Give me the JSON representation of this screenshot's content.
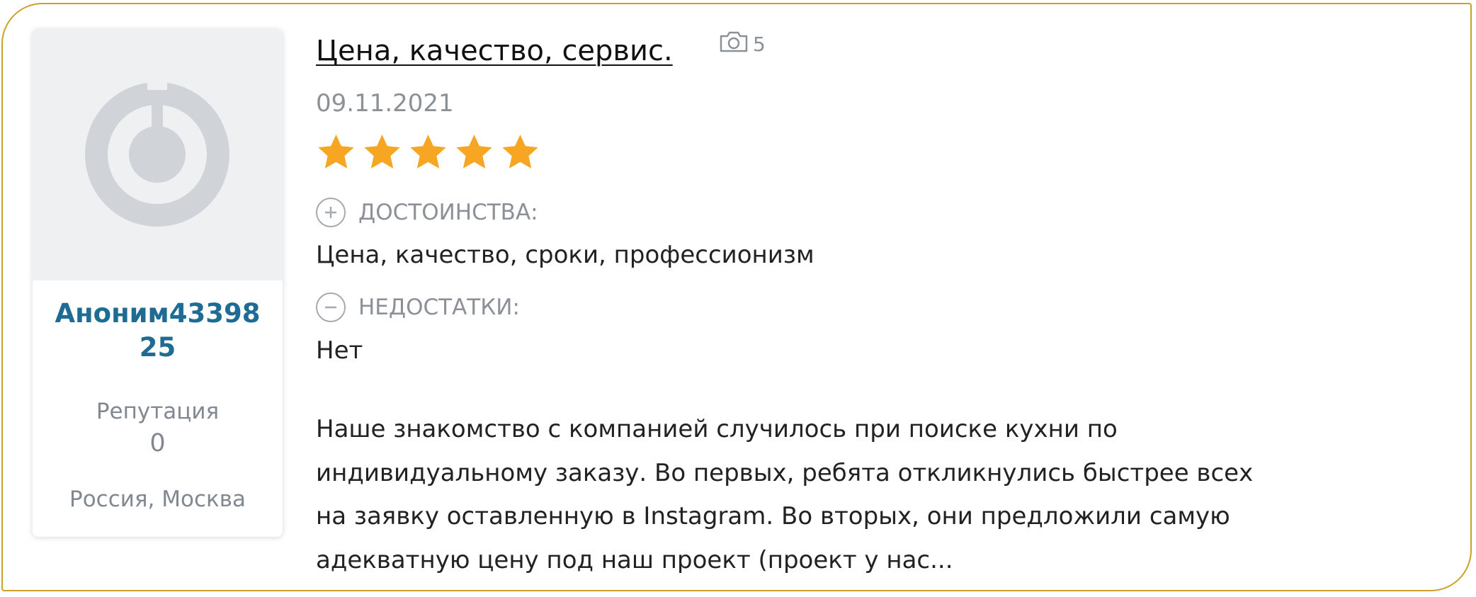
{
  "author": {
    "name": "Аноним4339825",
    "reputation_label": "Репутация",
    "reputation_value": "0",
    "location": "Россия, Москва"
  },
  "review": {
    "title": "Цена, качество, сервис.",
    "photo_count": "5",
    "date": "09.11.2021",
    "rating": 5,
    "rating_max": 5,
    "pros_label": "ДОСТОИНСТВА:",
    "pros_text": "Цена, качество, сроки, профессионизм",
    "cons_label": "НЕДОСТАТКИ:",
    "cons_text": "Нет",
    "body_lines": [
      "Наше знакомство с компанией случилось при поиске кухни по",
      "индивидуальному заказу. Во первых, ребята откликнулись быстрее всех",
      "на заявку оставленную в Instagram. Во вторых, они предложили самую",
      "адекватную цену под наш проект (проект у нас..."
    ]
  },
  "icons": {
    "avatar": "default-avatar-icon",
    "photo": "camera-icon",
    "star": "star-icon",
    "pros": "plus-circle-icon",
    "cons": "minus-circle-icon"
  },
  "colors": {
    "card_border": "#c9a227",
    "author_name": "#1e6b94",
    "star": "#f6a623",
    "muted_text": "#8c9198"
  }
}
